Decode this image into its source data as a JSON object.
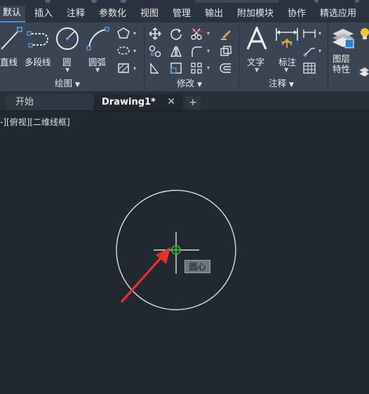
{
  "menu": {
    "tabs": [
      {
        "label": "默认",
        "active": true
      },
      {
        "label": "插入"
      },
      {
        "label": "注释"
      },
      {
        "label": "参数化"
      },
      {
        "label": "视图"
      },
      {
        "label": "管理"
      },
      {
        "label": "输出"
      },
      {
        "label": "附加模块"
      },
      {
        "label": "协作"
      },
      {
        "label": "精选应用"
      }
    ]
  },
  "ribbon": {
    "draw": {
      "title": "绘图",
      "tools": [
        {
          "label": "直线",
          "icon": "line-icon"
        },
        {
          "label": "多段线",
          "icon": "polyline-icon"
        },
        {
          "label": "圆",
          "icon": "circle-icon"
        },
        {
          "label": "圆弧",
          "icon": "arc-icon"
        }
      ]
    },
    "modify": {
      "title": "修改"
    },
    "annotation": {
      "title": "注释",
      "tools": [
        {
          "label": "文字",
          "icon": "text-icon"
        },
        {
          "label": "标注",
          "icon": "dimension-icon"
        }
      ]
    },
    "layers": {
      "label_line1": "图层",
      "label_line2": "特性",
      "icon": "layer-properties-icon"
    }
  },
  "docs": {
    "tabs": [
      {
        "label": "开始"
      },
      {
        "label": "Drawing1*",
        "active": true
      }
    ],
    "close": "✕",
    "add": "+"
  },
  "viewport": {
    "label": "-][俯视][二维线框]",
    "tooltip": "圆心",
    "colors": {
      "circle": "#dcdcdc",
      "crosshair": "#ffffff",
      "snap_marker": "#2fbf3f",
      "arrow": "#e8312c"
    }
  }
}
